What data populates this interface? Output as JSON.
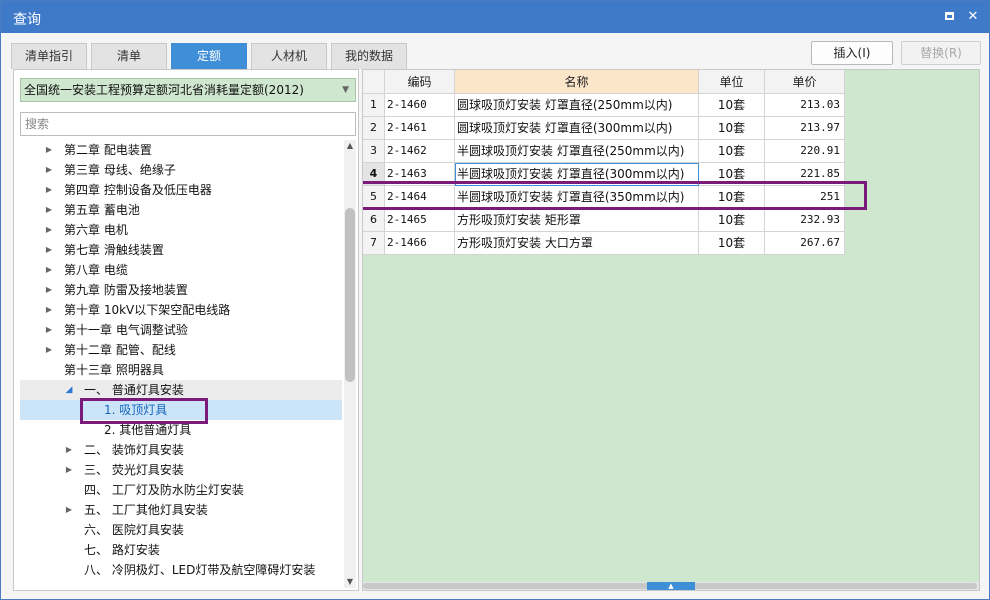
{
  "window": {
    "title": "查询"
  },
  "tabs": [
    {
      "label": "清单指引",
      "active": false
    },
    {
      "label": "清单",
      "active": false
    },
    {
      "label": "定额",
      "active": true
    },
    {
      "label": "人材机",
      "active": false
    },
    {
      "label": "我的数据",
      "active": false
    }
  ],
  "toolbar": {
    "insert_label": "插入(I)",
    "replace_label": "替换(R)"
  },
  "left": {
    "quota_library": "全国统一安装工程预算定额河北省消耗量定额(2012)",
    "search_placeholder": "搜索",
    "tree": [
      {
        "label": "第二章 配电装置",
        "level": 0,
        "arrow": "closed"
      },
      {
        "label": "第三章 母线、绝缘子",
        "level": 0,
        "arrow": "closed"
      },
      {
        "label": "第四章 控制设备及低压电器",
        "level": 0,
        "arrow": "closed"
      },
      {
        "label": "第五章 蓄电池",
        "level": 0,
        "arrow": "closed"
      },
      {
        "label": "第六章 电机",
        "level": 0,
        "arrow": "closed"
      },
      {
        "label": "第七章 滑触线装置",
        "level": 0,
        "arrow": "closed"
      },
      {
        "label": "第八章 电缆",
        "level": 0,
        "arrow": "closed"
      },
      {
        "label": "第九章 防雷及接地装置",
        "level": 0,
        "arrow": "closed"
      },
      {
        "label": "第十章 10kV以下架空配电线路",
        "level": 0,
        "arrow": "closed"
      },
      {
        "label": "第十一章 电气调整试验",
        "level": 0,
        "arrow": "closed"
      },
      {
        "label": "第十二章 配管、配线",
        "level": 0,
        "arrow": "closed"
      },
      {
        "label": "第十三章 照明器具",
        "level": 0,
        "arrow": "none"
      },
      {
        "label": "一、 普通灯具安装",
        "level": 1,
        "arrow": "open"
      },
      {
        "label": "1. 吸顶灯具",
        "level": 2,
        "arrow": "none",
        "selected": true
      },
      {
        "label": "2. 其他普通灯具",
        "level": 2,
        "arrow": "none"
      },
      {
        "label": "二、 装饰灯具安装",
        "level": 1,
        "arrow": "closed"
      },
      {
        "label": "三、 荧光灯具安装",
        "level": 1,
        "arrow": "closed"
      },
      {
        "label": "四、 工厂灯及防水防尘灯安装",
        "level": 1,
        "arrow": "none"
      },
      {
        "label": "五、 工厂其他灯具安装",
        "level": 1,
        "arrow": "closed"
      },
      {
        "label": "六、 医院灯具安装",
        "level": 1,
        "arrow": "none"
      },
      {
        "label": "七、 路灯安装",
        "level": 1,
        "arrow": "none"
      },
      {
        "label": "八、 冷阴极灯、LED灯带及航空障碍灯安装",
        "level": 1,
        "arrow": "none"
      }
    ]
  },
  "grid": {
    "columns": [
      "编码",
      "名称",
      "单位",
      "单价"
    ],
    "rows": [
      {
        "idx": "1",
        "code": "2-1460",
        "name": "圆球吸顶灯安装 灯罩直径(250mm以内)",
        "unit": "10套",
        "price": "213.03"
      },
      {
        "idx": "2",
        "code": "2-1461",
        "name": "圆球吸顶灯安装 灯罩直径(300mm以内)",
        "unit": "10套",
        "price": "213.97"
      },
      {
        "idx": "3",
        "code": "2-1462",
        "name": "半圆球吸顶灯安装 灯罩直径(250mm以内)",
        "unit": "10套",
        "price": "220.91"
      },
      {
        "idx": "4",
        "code": "2-1463",
        "name": "半圆球吸顶灯安装 灯罩直径(300mm以内)",
        "unit": "10套",
        "price": "221.85"
      },
      {
        "idx": "5",
        "code": "2-1464",
        "name": "半圆球吸顶灯安装 灯罩直径(350mm以内)",
        "unit": "10套",
        "price": "251"
      },
      {
        "idx": "6",
        "code": "2-1465",
        "name": "方形吸顶灯安装 矩形罩",
        "unit": "10套",
        "price": "232.93"
      },
      {
        "idx": "7",
        "code": "2-1466",
        "name": "方形吸顶灯安装 大口方罩",
        "unit": "10套",
        "price": "267.67"
      }
    ]
  },
  "colors": {
    "title_bar": "#3f7ac8",
    "active_tab": "#3f8fd8",
    "grid_background": "#cfe6cf",
    "name_header": "#fbe6c9",
    "highlight_box": "#7a1a7a",
    "tree_selected": "#cce4f7"
  }
}
